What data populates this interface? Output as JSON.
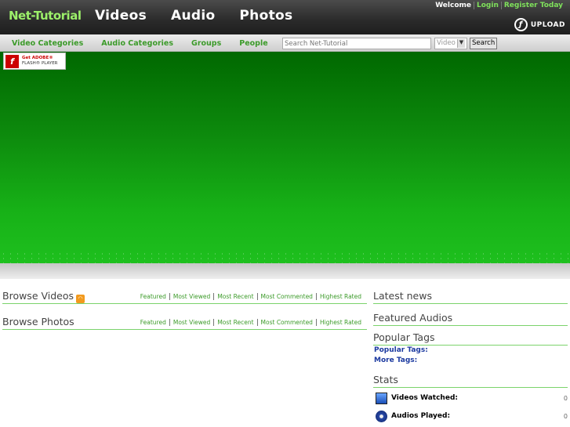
{
  "header": {
    "brand": "Net-Tutorial",
    "nav": [
      "Videos",
      "Audio",
      "Photos"
    ],
    "welcome": "Welcome",
    "login": "Login",
    "register": "Register Today",
    "upload": "UPLOAD",
    "upload_icon": "upload-icon"
  },
  "subnav": {
    "items": [
      "Video Categories",
      "Audio Categories",
      "Groups",
      "People"
    ],
    "search_placeholder": "Search Net-Tutorial",
    "search_type": "Video",
    "search_button": "Search"
  },
  "player": {
    "flash_line1": "Get ADOBE®",
    "flash_line2": "FLASH® PLAYER",
    "accent": "#17b117"
  },
  "browse_videos": {
    "title": "Browse Videos",
    "tabs": [
      "Featured",
      "Most Viewed",
      "Most Recent",
      "Most Commented",
      "Highest Rated"
    ]
  },
  "browse_photos": {
    "title": "Browse Photos",
    "tabs": [
      "Featured",
      "Most Viewed",
      "Most Recent",
      "Most Commented",
      "Highest Rated"
    ]
  },
  "sidebar": {
    "latest_news": "Latest news",
    "featured_audios": "Featured Audios",
    "popular_tags": "Popular Tags",
    "popular_tags_link": "Popular Tags:",
    "more_tags_link": "More Tags:",
    "stats": "Stats",
    "stat_items": [
      {
        "label": "Videos Watched:",
        "value": "0",
        "icon": "monitor-icon"
      },
      {
        "label": "Audios Played:",
        "value": "0",
        "icon": "disc-icon"
      }
    ]
  },
  "colors": {
    "link_green": "#3c9b2a",
    "brand_green": "#9cf06a",
    "tag_blue": "#1c3aa0"
  }
}
